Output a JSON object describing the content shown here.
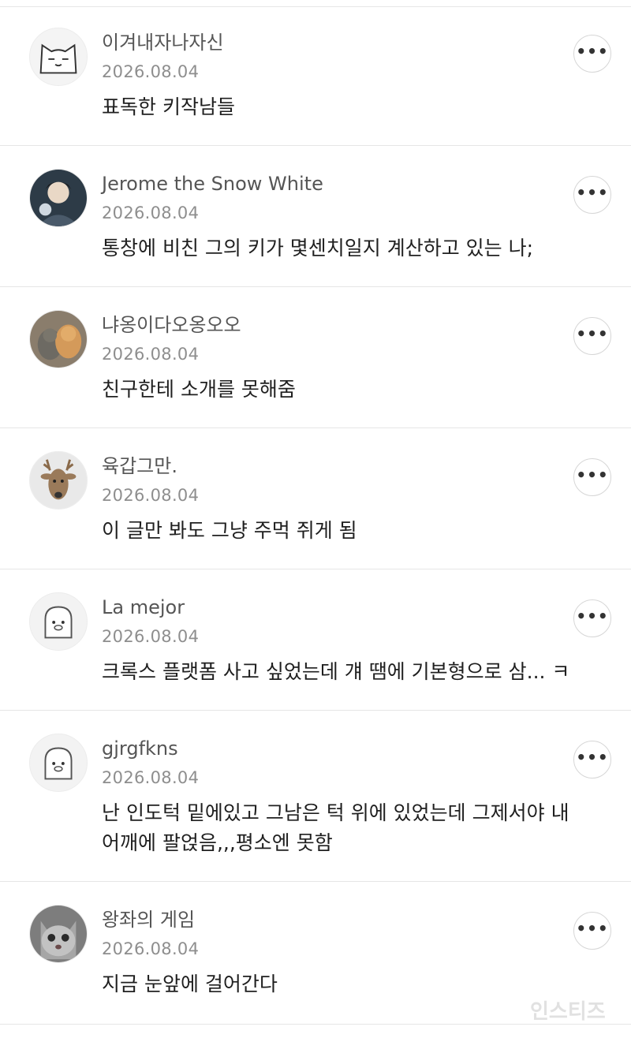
{
  "more_glyph": "•••",
  "comments": [
    {
      "author": "이겨내자나자신",
      "date": "2026.08.04",
      "text": "표독한 키작남들",
      "avatar_icon": "white-cat-avatar-icon"
    },
    {
      "author": "Jerome the Snow White",
      "date": "2026.08.04",
      "text": "통창에 비친 그의 키가 몇센치일지 계산하고 있는 나;",
      "avatar_icon": "anime-man-avatar-icon"
    },
    {
      "author": "냐옹이다오옹오오",
      "date": "2026.08.04",
      "text": "친구한테 소개를 못해줌",
      "avatar_icon": "two-cats-avatar-icon"
    },
    {
      "author": "육갑그만.",
      "date": "2026.08.04",
      "text": "이 글만 봐도 그냥 주먹 쥐게 됨",
      "avatar_icon": "deer-avatar-icon"
    },
    {
      "author": "La mejor",
      "date": "2026.08.04",
      "text": "크록스 플랫폼 사고 싶었는데 걔 땜에 기본형으로 삼... ㅋ",
      "avatar_icon": "default-character-avatar-icon"
    },
    {
      "author": "gjrgfkns",
      "date": "2026.08.04",
      "text": "난 인도턱 밑에있고 그남은 턱 위에 있었는데 그제서야 내\n어깨에 팔얹음,,,평소엔 못함",
      "avatar_icon": "default-character-avatar-icon"
    },
    {
      "author": "왕좌의 게임",
      "date": "2026.08.04",
      "text": "지금 눈앞에 걸어간다",
      "avatar_icon": "gray-cat-avatar-icon"
    }
  ],
  "watermark": "인스티즈"
}
